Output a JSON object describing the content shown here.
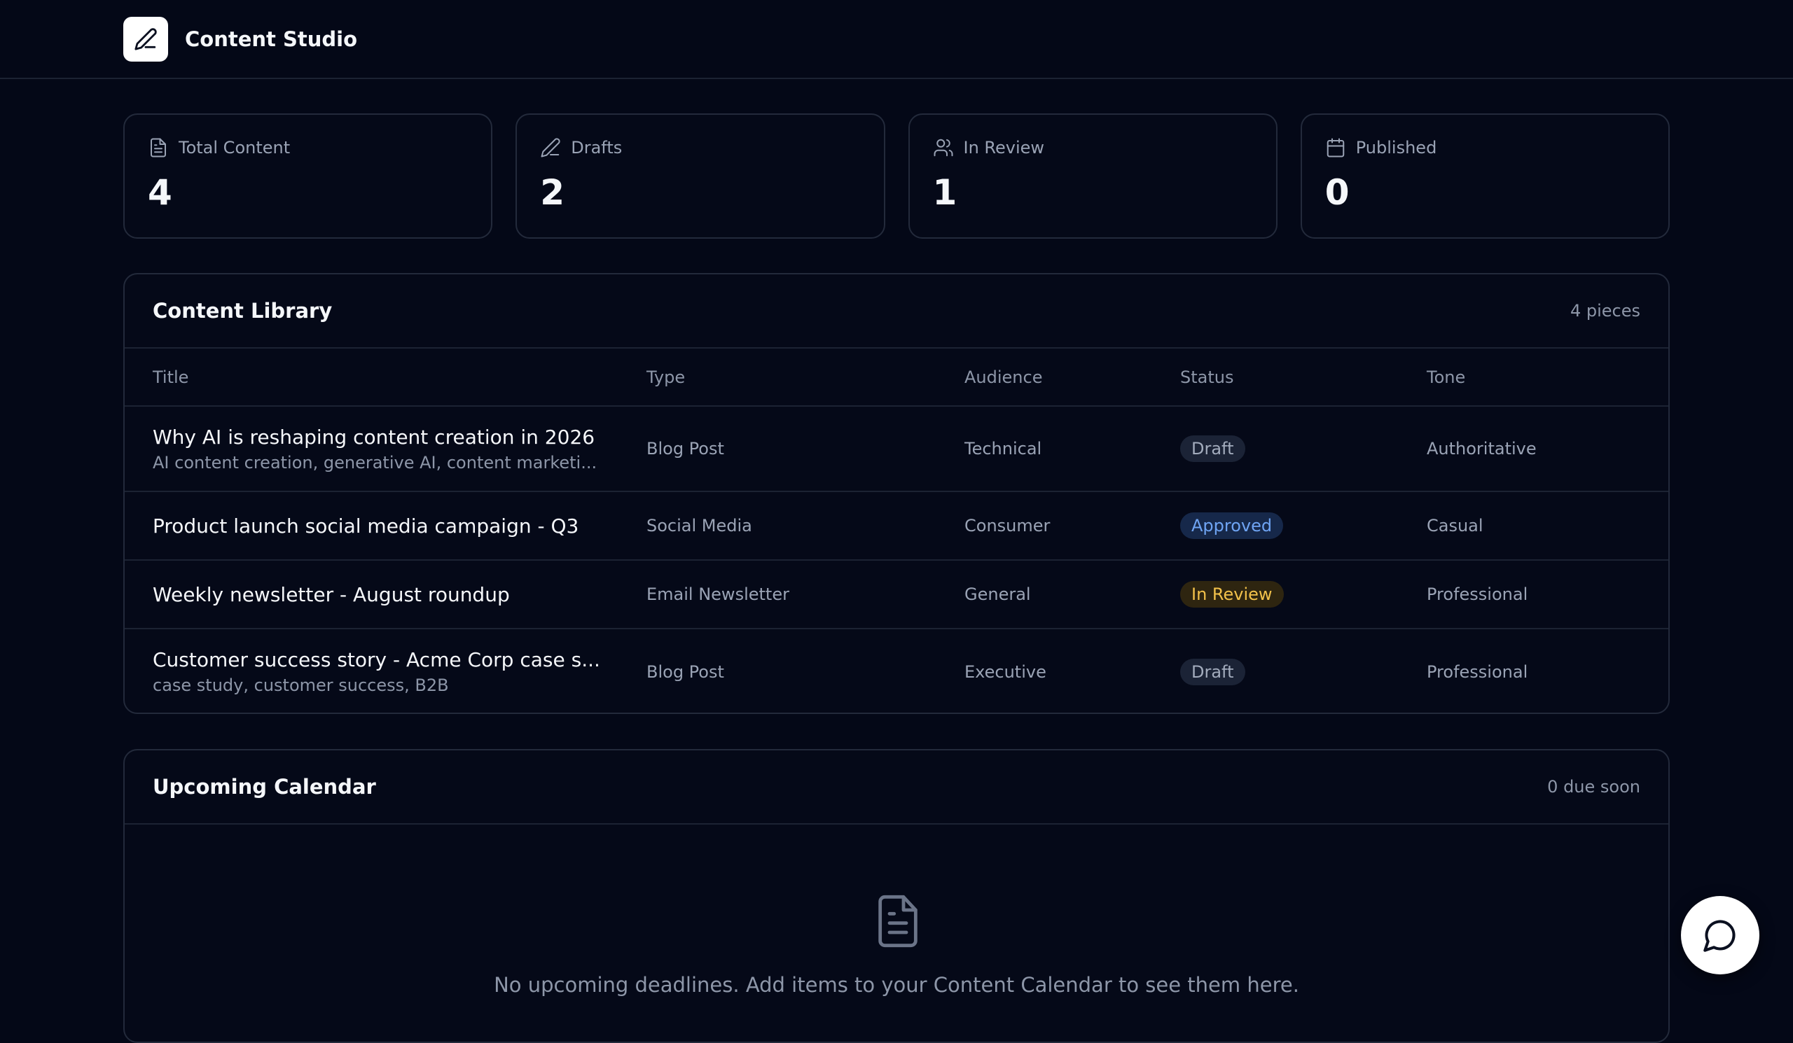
{
  "app": {
    "title": "Content Studio",
    "logo_icon": "pencil-icon"
  },
  "stats": [
    {
      "icon": "document-icon",
      "label": "Total Content",
      "value": "4"
    },
    {
      "icon": "pencil-icon",
      "label": "Drafts",
      "value": "2"
    },
    {
      "icon": "users-icon",
      "label": "In Review",
      "value": "1"
    },
    {
      "icon": "calendar-icon",
      "label": "Published",
      "value": "0"
    }
  ],
  "library": {
    "title": "Content Library",
    "count_label": "4 pieces",
    "columns": [
      "Title",
      "Type",
      "Audience",
      "Status",
      "Tone"
    ],
    "rows": [
      {
        "title": "Why AI is reshaping content creation in 2026",
        "subtitle": "AI content creation, generative AI, content marketi...",
        "type": "Blog Post",
        "audience": "Technical",
        "status": "Draft",
        "tone": "Authoritative"
      },
      {
        "title": "Product launch social media campaign - Q3",
        "subtitle": "",
        "type": "Social Media",
        "audience": "Consumer",
        "status": "Approved",
        "tone": "Casual"
      },
      {
        "title": "Weekly newsletter - August roundup",
        "subtitle": "",
        "type": "Email Newsletter",
        "audience": "General",
        "status": "In Review",
        "tone": "Professional"
      },
      {
        "title": "Customer success story - Acme Corp case s...",
        "subtitle": "case study, customer success, B2B",
        "type": "Blog Post",
        "audience": "Executive",
        "status": "Draft",
        "tone": "Professional"
      }
    ]
  },
  "calendar": {
    "title": "Upcoming Calendar",
    "count_label": "0 due soon",
    "empty_icon": "document-icon",
    "empty_text": "No upcoming deadlines. Add items to your Content Calendar to see them here."
  },
  "chat": {
    "icon": "chat-bubble-icon"
  },
  "colors": {
    "background": "#040817",
    "draft": "#a3acbd",
    "approved": "#6fa4f3",
    "in_review": "#f2c14a"
  }
}
